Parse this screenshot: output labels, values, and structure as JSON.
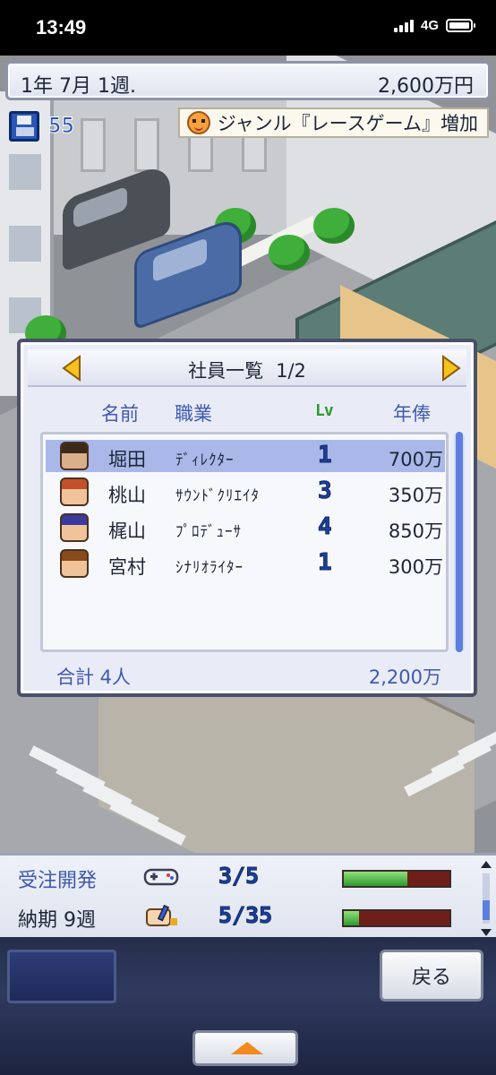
{
  "status": {
    "time": "13:49",
    "network": "4G"
  },
  "top_bar": {
    "date": "1年 7月 1週.",
    "money": "2,600万円"
  },
  "save_count": "55",
  "notice": {
    "text": "ジャンル『レースゲーム』増加",
    "icon": "smiley-face-icon"
  },
  "dialog": {
    "title": "社員一覧",
    "page": "1/2",
    "columns": {
      "name": "名前",
      "job": "職業",
      "level": "Lv",
      "salary": "年俸"
    },
    "staff": [
      {
        "name": "堀田",
        "job": "ﾃﾞｨﾚｸﾀｰ",
        "level": "1",
        "salary": "700万",
        "selected": true,
        "avatar_color": "#d9b08a",
        "hair_color": "#3a2a1a"
      },
      {
        "name": "桃山",
        "job": "ｻｳﾝﾄﾞｸﾘｴｲﾀ",
        "level": "3",
        "salary": "350万",
        "selected": false,
        "avatar_color": "#f0c39a",
        "hair_color": "#c2502a"
      },
      {
        "name": "梶山",
        "job": "ﾌﾟﾛﾃﾞｭｰｻ",
        "level": "4",
        "salary": "850万",
        "selected": false,
        "avatar_color": "#f0c39a",
        "hair_color": "#3a3aa0"
      },
      {
        "name": "宮村",
        "job": "ｼﾅﾘｵﾗｲﾀｰ",
        "level": "1",
        "salary": "300万",
        "selected": false,
        "avatar_color": "#f0c39a",
        "hair_color": "#8a4a1c"
      }
    ],
    "footer": {
      "total": "合計 4人",
      "total_salary": "2,200万"
    }
  },
  "project": {
    "order_label": "受注開発",
    "order_icon": "gamepad-icon",
    "order_count": "3/5",
    "order_progress": 0.6,
    "deadline_label": "納期 9週",
    "deadline_icon": "writing-hand-icon",
    "deadline_count": "5/35",
    "deadline_progress": 0.14
  },
  "buttons": {
    "back": "戻る"
  },
  "colors": {
    "accent_blue": "#3f58b0",
    "selected_row": "#a9b8e9",
    "arrow_yellow": "#f6c21c",
    "progress_green": "#2e9a2e",
    "up_arrow": "#f28a1f"
  }
}
